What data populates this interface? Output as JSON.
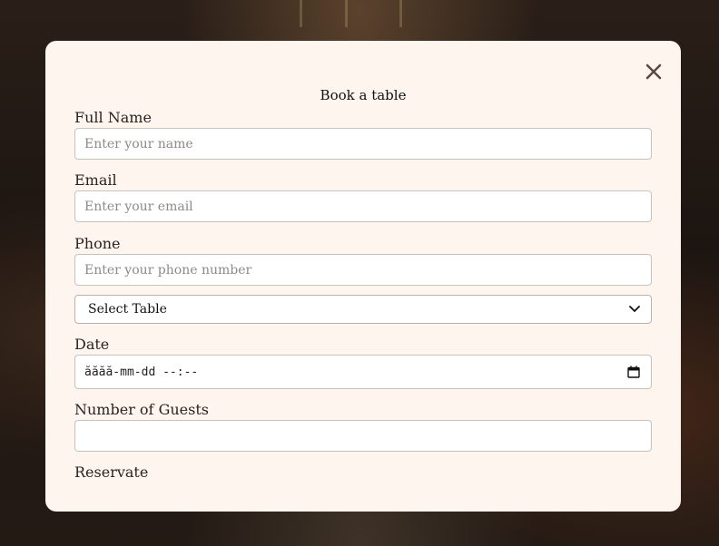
{
  "modal": {
    "title": "Book a table",
    "close_icon": "close-icon"
  },
  "form": {
    "full_name": {
      "label": "Full Name",
      "placeholder": "Enter your name",
      "value": ""
    },
    "email": {
      "label": "Email",
      "placeholder": "Enter your email",
      "value": ""
    },
    "phone": {
      "label": "Phone",
      "placeholder": "Enter your phone number",
      "value": ""
    },
    "table_select": {
      "selected": "Select Table",
      "icon": "chevron-down-icon"
    },
    "date": {
      "label": "Date",
      "display": "ăăăă-mm-dd --:--",
      "icon": "calendar-icon"
    },
    "guests": {
      "label": "Number of Guests",
      "value": ""
    },
    "submit_label": "Reservate"
  },
  "colors": {
    "modal_bg": "#fdf5ee",
    "text": "#2a2420",
    "border": "#c9c2bc",
    "placeholder": "#8e8a87"
  }
}
